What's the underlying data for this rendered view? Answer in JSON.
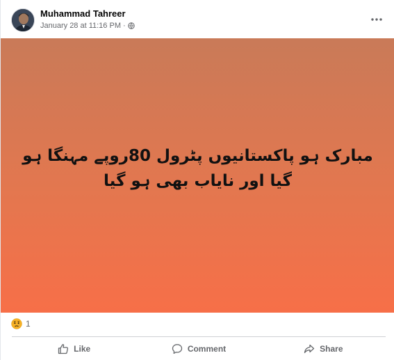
{
  "post": {
    "author": "Muhammad Tahreer",
    "timestamp": "January 28 at 11:16 PM",
    "separator": "·",
    "privacy_icon": "globe-icon",
    "more_icon": "more-options-icon",
    "text": "مبارک ہو پاکستانیوں پٹرول 80روپے مہنگا ہو گیا اور نایاب بھی ہو گیا",
    "background_gradient": [
      "#c97a58",
      "#f76f48"
    ]
  },
  "reactions": {
    "icon": "sad-reaction-icon",
    "count": "1"
  },
  "actions": {
    "like_label": "Like",
    "comment_label": "Comment",
    "share_label": "Share"
  }
}
